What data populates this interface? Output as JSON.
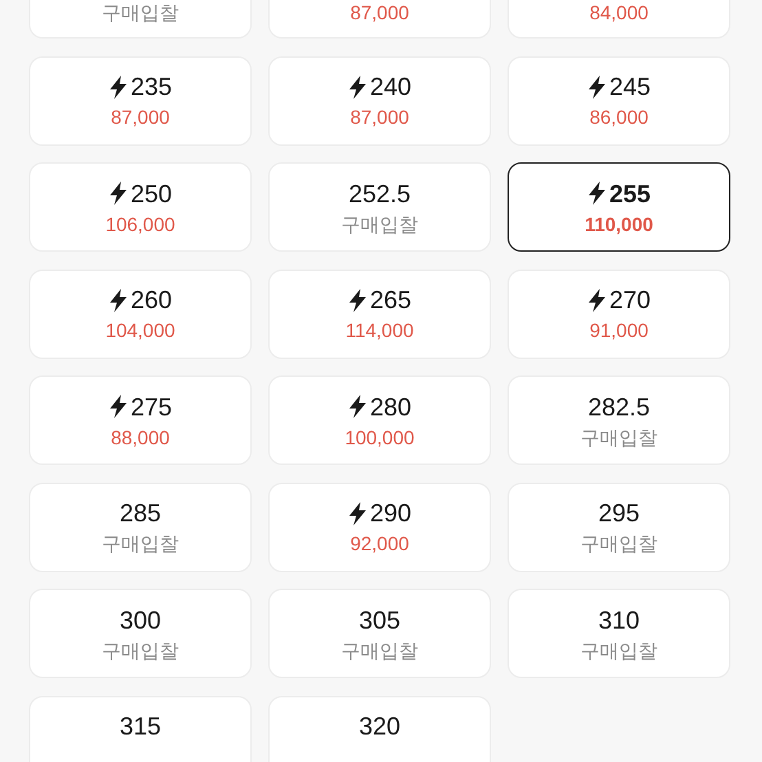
{
  "partial_row": [
    {
      "kind": "bid",
      "price": "구매입찰"
    },
    {
      "kind": "price",
      "price": "87,000"
    },
    {
      "kind": "price",
      "price": "84,000"
    }
  ],
  "sizes": [
    {
      "size": "235",
      "fast": true,
      "kind": "price",
      "price": "87,000",
      "selected": false
    },
    {
      "size": "240",
      "fast": true,
      "kind": "price",
      "price": "87,000",
      "selected": false
    },
    {
      "size": "245",
      "fast": true,
      "kind": "price",
      "price": "86,000",
      "selected": false
    },
    {
      "size": "250",
      "fast": true,
      "kind": "price",
      "price": "106,000",
      "selected": false
    },
    {
      "size": "252.5",
      "fast": false,
      "kind": "bid",
      "price": "구매입찰",
      "selected": false
    },
    {
      "size": "255",
      "fast": true,
      "kind": "price",
      "price": "110,000",
      "selected": true
    },
    {
      "size": "260",
      "fast": true,
      "kind": "price",
      "price": "104,000",
      "selected": false
    },
    {
      "size": "265",
      "fast": true,
      "kind": "price",
      "price": "114,000",
      "selected": false
    },
    {
      "size": "270",
      "fast": true,
      "kind": "price",
      "price": "91,000",
      "selected": false
    },
    {
      "size": "275",
      "fast": true,
      "kind": "price",
      "price": "88,000",
      "selected": false
    },
    {
      "size": "280",
      "fast": true,
      "kind": "price",
      "price": "100,000",
      "selected": false
    },
    {
      "size": "282.5",
      "fast": false,
      "kind": "bid",
      "price": "구매입찰",
      "selected": false
    },
    {
      "size": "285",
      "fast": false,
      "kind": "bid",
      "price": "구매입찰",
      "selected": false
    },
    {
      "size": "290",
      "fast": true,
      "kind": "price",
      "price": "92,000",
      "selected": false
    },
    {
      "size": "295",
      "fast": false,
      "kind": "bid",
      "price": "구매입찰",
      "selected": false
    },
    {
      "size": "300",
      "fast": false,
      "kind": "bid",
      "price": "구매입찰",
      "selected": false
    },
    {
      "size": "305",
      "fast": false,
      "kind": "bid",
      "price": "구매입찰",
      "selected": false
    },
    {
      "size": "310",
      "fast": false,
      "kind": "bid",
      "price": "구매입찰",
      "selected": false
    },
    {
      "size": "315",
      "fast": false,
      "selected": false
    },
    {
      "size": "320",
      "fast": false,
      "selected": false
    }
  ]
}
